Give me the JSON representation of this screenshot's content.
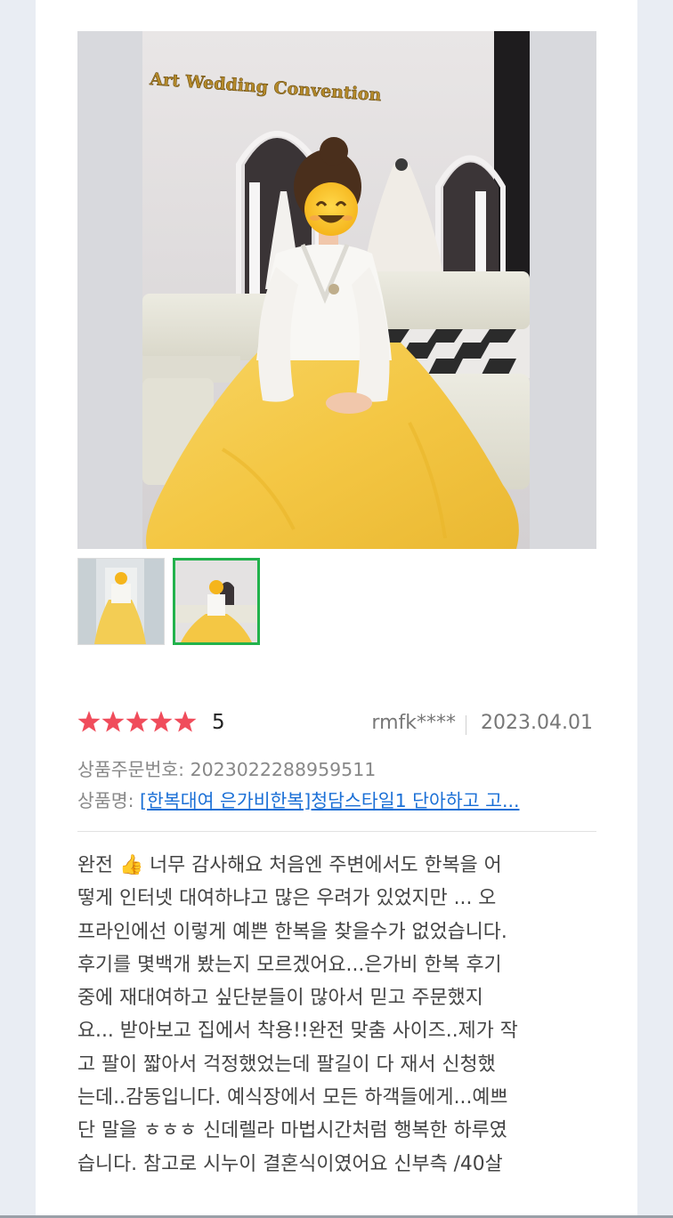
{
  "photo": {
    "signage": "Art Wedding Convention"
  },
  "rating": {
    "stars": 5,
    "score": "5",
    "star_color": "#f04c5b"
  },
  "reviewer": "rmfk****",
  "date": "2023.04.01",
  "order": {
    "label": "상품주문번호: ",
    "value": "2023022288959511"
  },
  "product": {
    "label": "상품명: ",
    "value": "[한복대여 은가비한복]청담스타일1 단아하고 고..."
  },
  "thumbnails": {
    "selected_border_color": "#22b24c"
  },
  "review_lines": [
    "완전 👍 너무 감사해요 처음엔 주변에서도 한복을 어",
    "떻게 인터넷 대여하냐고 많은 우려가 있었지만 ... 오",
    "프라인에선 이렇게 예쁜 한복을 찾을수가 없었습니다.",
    "후기를 몇백개 봤는지 모르겠어요...은가비 한복 후기",
    "중에 재대여하고 싶단분들이 많아서 믿고 주문했지",
    "요... 받아보고 집에서 착용!!완전 맞춤 사이즈..제가 작",
    "고 팔이 짧아서 걱정했었는데 팔길이 다 재서 신청했",
    "는데..감동입니다. 예식장에서 모든 하객들에게...예쁘",
    "단 말을 ㅎㅎㅎ 신데렐라 마법시간처럼 행복한 하루였",
    "습니다. 참고로 시누이 결혼식이였어요 신부측 /40살"
  ]
}
